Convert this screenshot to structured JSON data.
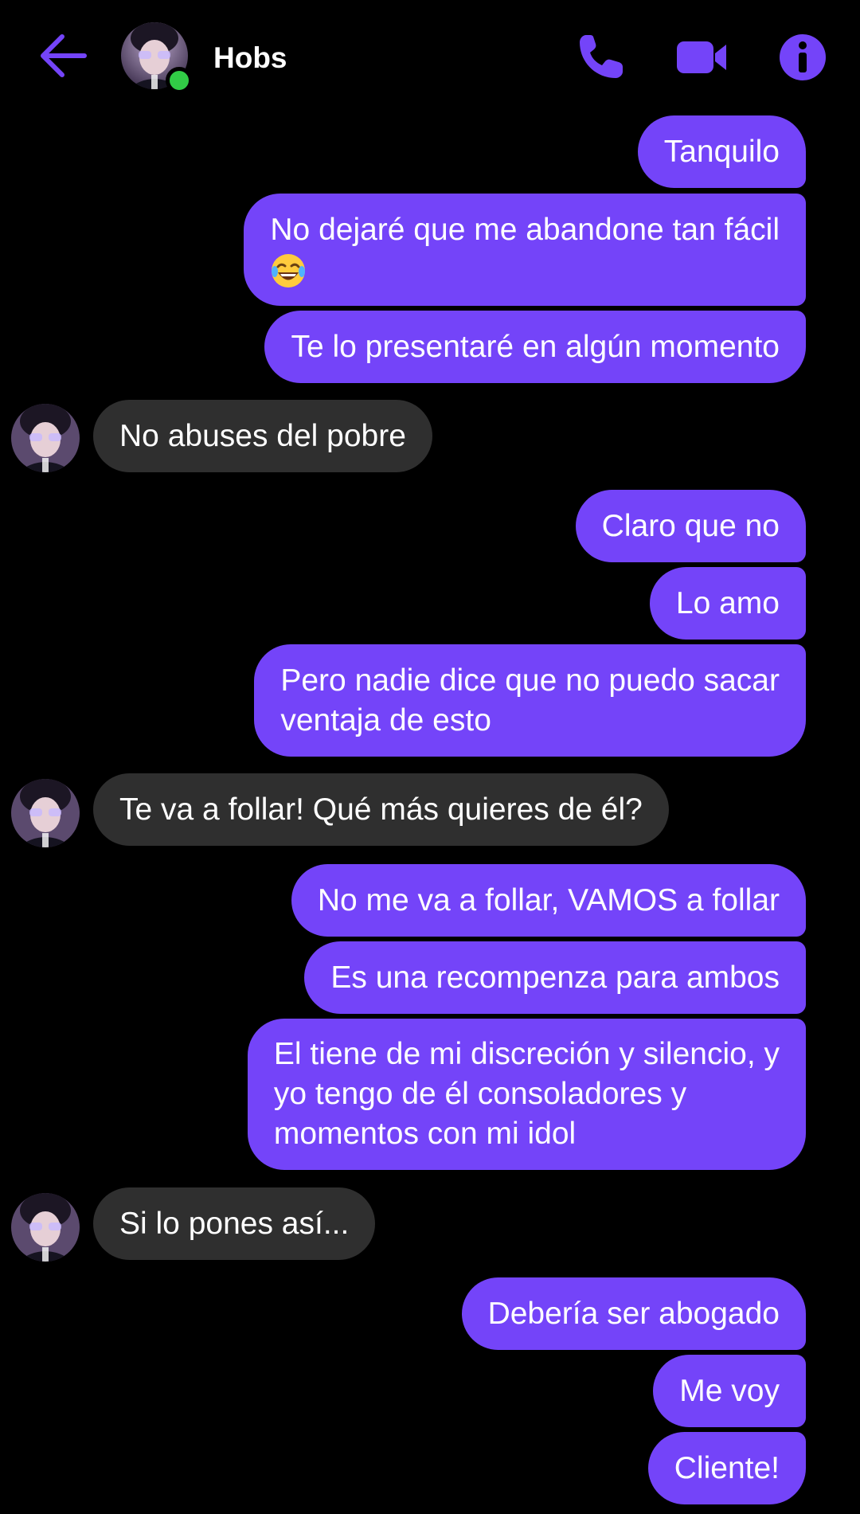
{
  "header": {
    "contact_name": "Hobs",
    "online": true,
    "icons": [
      "arrow-left-icon",
      "phone-icon",
      "video-camera-icon",
      "info-icon"
    ]
  },
  "colors": {
    "background": "#000000",
    "accent": "#7444f9",
    "sent_bubble": "#7444f9",
    "received_bubble": "#2f2f2f",
    "online_dot": "#31cc46"
  },
  "messages": [
    {
      "from": "me",
      "lines": [
        "Tanquilo"
      ]
    },
    {
      "from": "me",
      "lines": [
        "No dejaré que me abandone tan fácil",
        "😂"
      ]
    },
    {
      "from": "me",
      "lines": [
        "Te lo presentaré en algún momento"
      ]
    },
    {
      "from": "Hobs",
      "lines": [
        "No abuses del pobre"
      ]
    },
    {
      "from": "me",
      "lines": [
        "Claro que no"
      ]
    },
    {
      "from": "me",
      "lines": [
        "Lo amo"
      ]
    },
    {
      "from": "me",
      "lines": [
        "Pero nadie dice que no puedo sacar",
        "ventaja de esto"
      ]
    },
    {
      "from": "Hobs",
      "lines": [
        "Te va a follar! Qué más quieres de él?"
      ]
    },
    {
      "from": "me",
      "lines": [
        "No me va a follar, VAMOS a follar"
      ]
    },
    {
      "from": "me",
      "lines": [
        "Es una recompenza para ambos"
      ]
    },
    {
      "from": "me",
      "lines": [
        "El tiene de mi discreción y silencio, y",
        "yo tengo de él consoladores y",
        "momentos con mi idol"
      ]
    },
    {
      "from": "Hobs",
      "lines": [
        "Si lo pones así..."
      ]
    },
    {
      "from": "me",
      "lines": [
        "Debería ser abogado"
      ]
    },
    {
      "from": "me",
      "lines": [
        "Me voy"
      ]
    },
    {
      "from": "me",
      "lines": [
        "Cliente!"
      ]
    }
  ]
}
